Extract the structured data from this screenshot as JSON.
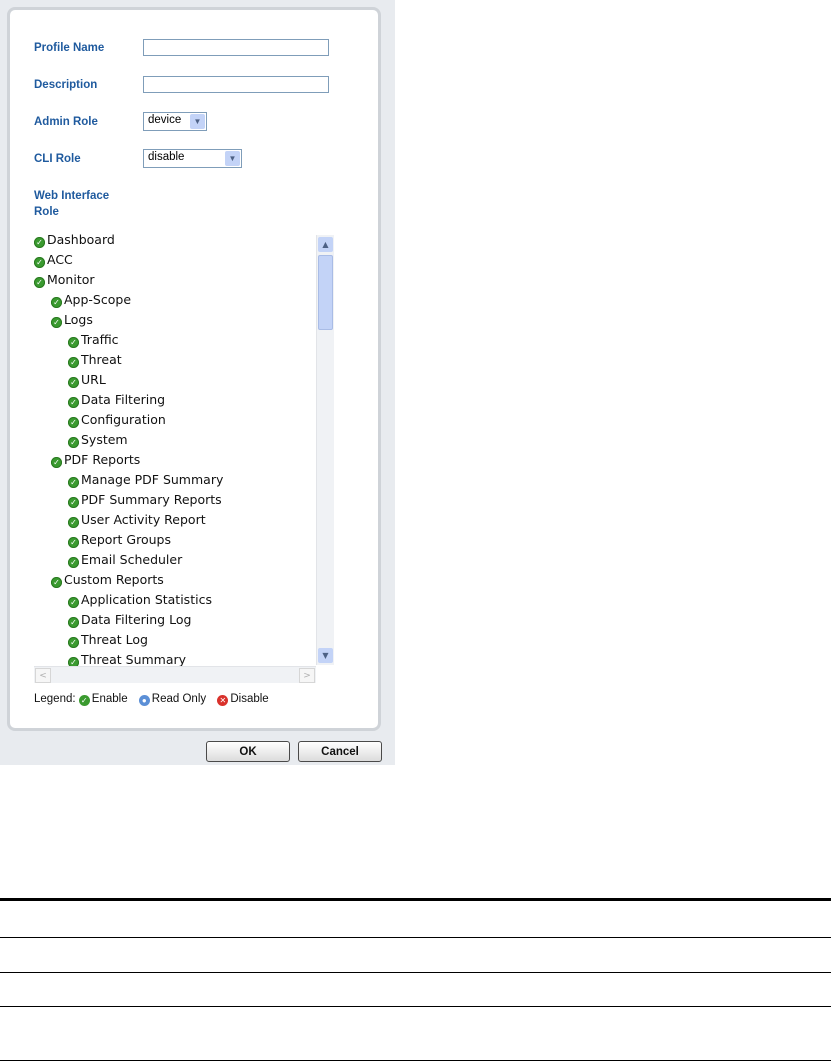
{
  "form": {
    "profile_name_label": "Profile Name",
    "description_label": "Description",
    "admin_role_label": "Admin Role",
    "admin_role_value": "device",
    "cli_role_label": "CLI Role",
    "cli_role_value": "disable",
    "web_interface_role_label_line1": "Web Interface",
    "web_interface_role_label_line2": "Role"
  },
  "tree": {
    "items": [
      {
        "label": "Dashboard",
        "level": 0,
        "state": "enable"
      },
      {
        "label": "ACC",
        "level": 0,
        "state": "enable"
      },
      {
        "label": "Monitor",
        "level": 0,
        "state": "enable"
      },
      {
        "label": "App-Scope",
        "level": 1,
        "state": "enable"
      },
      {
        "label": "Logs",
        "level": 1,
        "state": "enable"
      },
      {
        "label": "Traffic",
        "level": 2,
        "state": "enable"
      },
      {
        "label": "Threat",
        "level": 2,
        "state": "enable"
      },
      {
        "label": "URL",
        "level": 2,
        "state": "enable"
      },
      {
        "label": "Data Filtering",
        "level": 2,
        "state": "enable"
      },
      {
        "label": "Configuration",
        "level": 2,
        "state": "enable"
      },
      {
        "label": "System",
        "level": 2,
        "state": "enable"
      },
      {
        "label": "PDF Reports",
        "level": 1,
        "state": "enable"
      },
      {
        "label": "Manage PDF Summary",
        "level": 2,
        "state": "enable"
      },
      {
        "label": "PDF Summary Reports",
        "level": 2,
        "state": "enable"
      },
      {
        "label": "User Activity Report",
        "level": 2,
        "state": "enable"
      },
      {
        "label": "Report Groups",
        "level": 2,
        "state": "enable"
      },
      {
        "label": "Email Scheduler",
        "level": 2,
        "state": "enable"
      },
      {
        "label": "Custom Reports",
        "level": 1,
        "state": "enable"
      },
      {
        "label": "Application Statistics",
        "level": 2,
        "state": "enable"
      },
      {
        "label": "Data Filtering Log",
        "level": 2,
        "state": "enable"
      },
      {
        "label": "Threat Log",
        "level": 2,
        "state": "enable"
      },
      {
        "label": "Threat Summary",
        "level": 2,
        "state": "enable"
      }
    ]
  },
  "legend": {
    "title": "Legend:",
    "enable": "Enable",
    "read_only": "Read Only",
    "disable": "Disable"
  },
  "buttons": {
    "ok": "OK",
    "cancel": "Cancel"
  },
  "colors": {
    "label_blue": "#1f5a9e",
    "enable_green": "#3a9a2f",
    "read_only_blue": "#5b8fd6",
    "disable_red": "#d9312b"
  },
  "icons": {
    "enable": "check-circle-icon",
    "read_only": "lock-circle-icon",
    "disable": "x-circle-icon"
  }
}
